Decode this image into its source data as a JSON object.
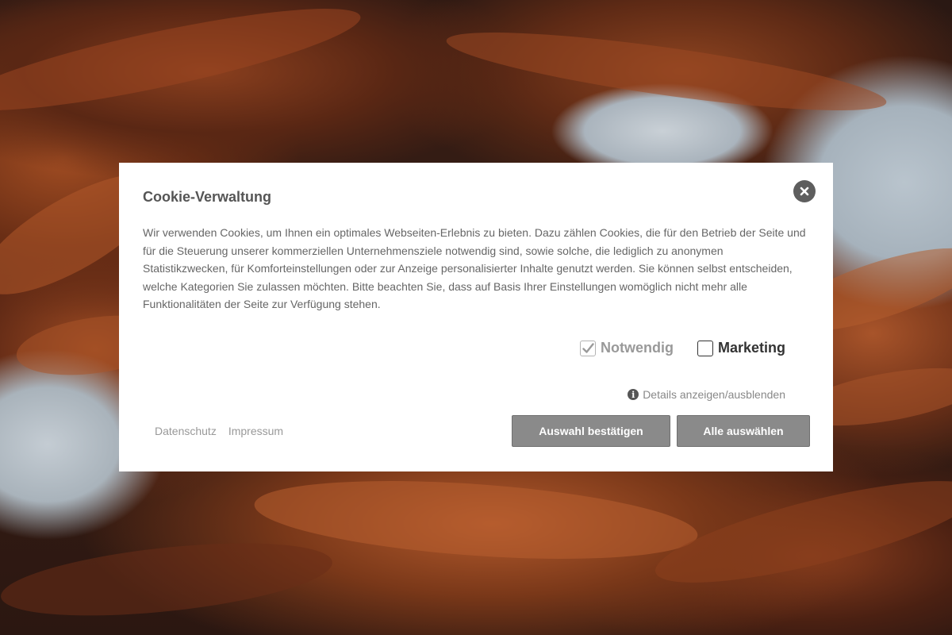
{
  "modal": {
    "title": "Cookie-Verwaltung",
    "description": "Wir verwenden Cookies, um Ihnen ein optimales Webseiten-Erlebnis zu bieten. Dazu zählen Cookies, die für den Betrieb der Seite und für die Steuerung unserer kommerziellen Unternehmensziele notwendig sind, sowie solche, die lediglich zu anonymen Statistikzwecken, für Komforteinstellungen oder zur Anzeige personalisierter Inhalte genutzt werden. Sie können selbst entscheiden, welche Kategorien Sie zulassen möchten. Bitte beachten Sie, dass auf Basis Ihrer Einstellungen womöglich nicht mehr alle Funktionalitäten der Seite zur Verfügung stehen.",
    "close_icon": "close-icon",
    "options": [
      {
        "label": "Notwendig",
        "checked": true,
        "disabled": true
      },
      {
        "label": "Marketing",
        "checked": false,
        "disabled": false
      }
    ],
    "details_label": "Details anzeigen/ausblenden",
    "details_icon": "info-icon",
    "links": {
      "privacy": "Datenschutz",
      "imprint": "Impressum"
    },
    "buttons": {
      "confirm": "Auswahl bestätigen",
      "select_all": "Alle auswählen"
    }
  },
  "colors": {
    "button_bg": "#8a8a8a",
    "title": "#555555",
    "text": "#666666",
    "close_bg": "#5e5e5e"
  }
}
